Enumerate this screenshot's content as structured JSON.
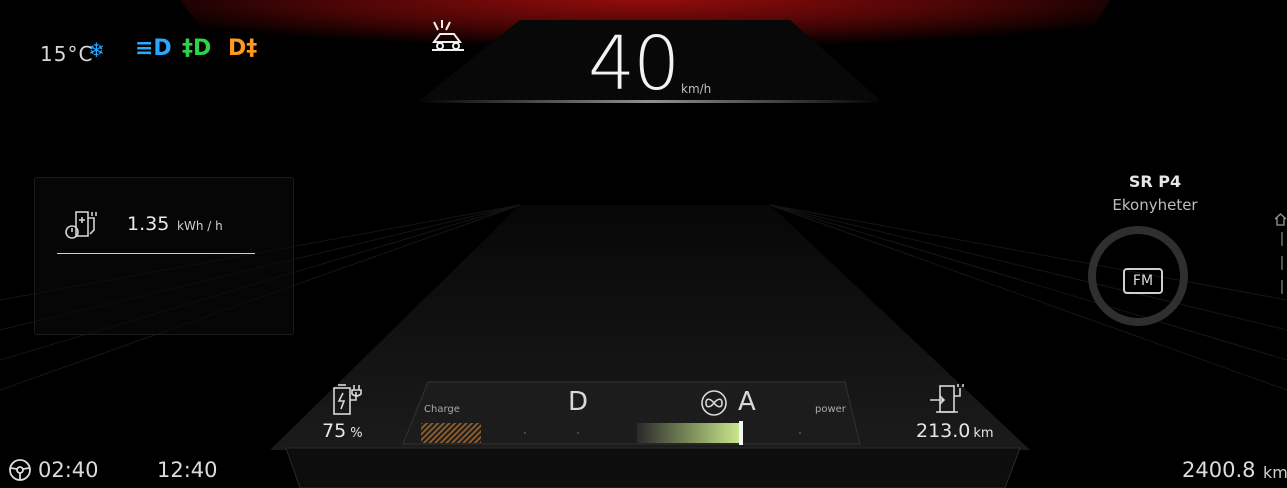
{
  "status": {
    "temperature": "15°C",
    "snowflake_icon": "❄",
    "headlight_icon": "≡D",
    "front_fog_icon": "‡D",
    "rear_fog_icon": "D‡"
  },
  "speed": {
    "value": "40",
    "unit": "km/h"
  },
  "consumption": {
    "value": "1.35",
    "unit": "kWh / h"
  },
  "radio": {
    "station": "SR P4",
    "program": "Ekonyheter",
    "band": "FM"
  },
  "battery": {
    "percent": "75",
    "unit": "%"
  },
  "range": {
    "value": "213.0",
    "unit": "km"
  },
  "drive": {
    "gear": "D",
    "mode": "A",
    "charge_label": "Charge",
    "power_label": "power"
  },
  "bottom": {
    "trip_time": "02:40",
    "clock": "12:40",
    "odometer": "2400.8",
    "odometer_unit": "km"
  },
  "colors": {
    "accent_red": "#8b0b0b",
    "blue_light": "#2aa7ff",
    "green_light": "#2ed34a",
    "amber_light": "#ff9a1f",
    "power_green": "#bfe07a"
  }
}
